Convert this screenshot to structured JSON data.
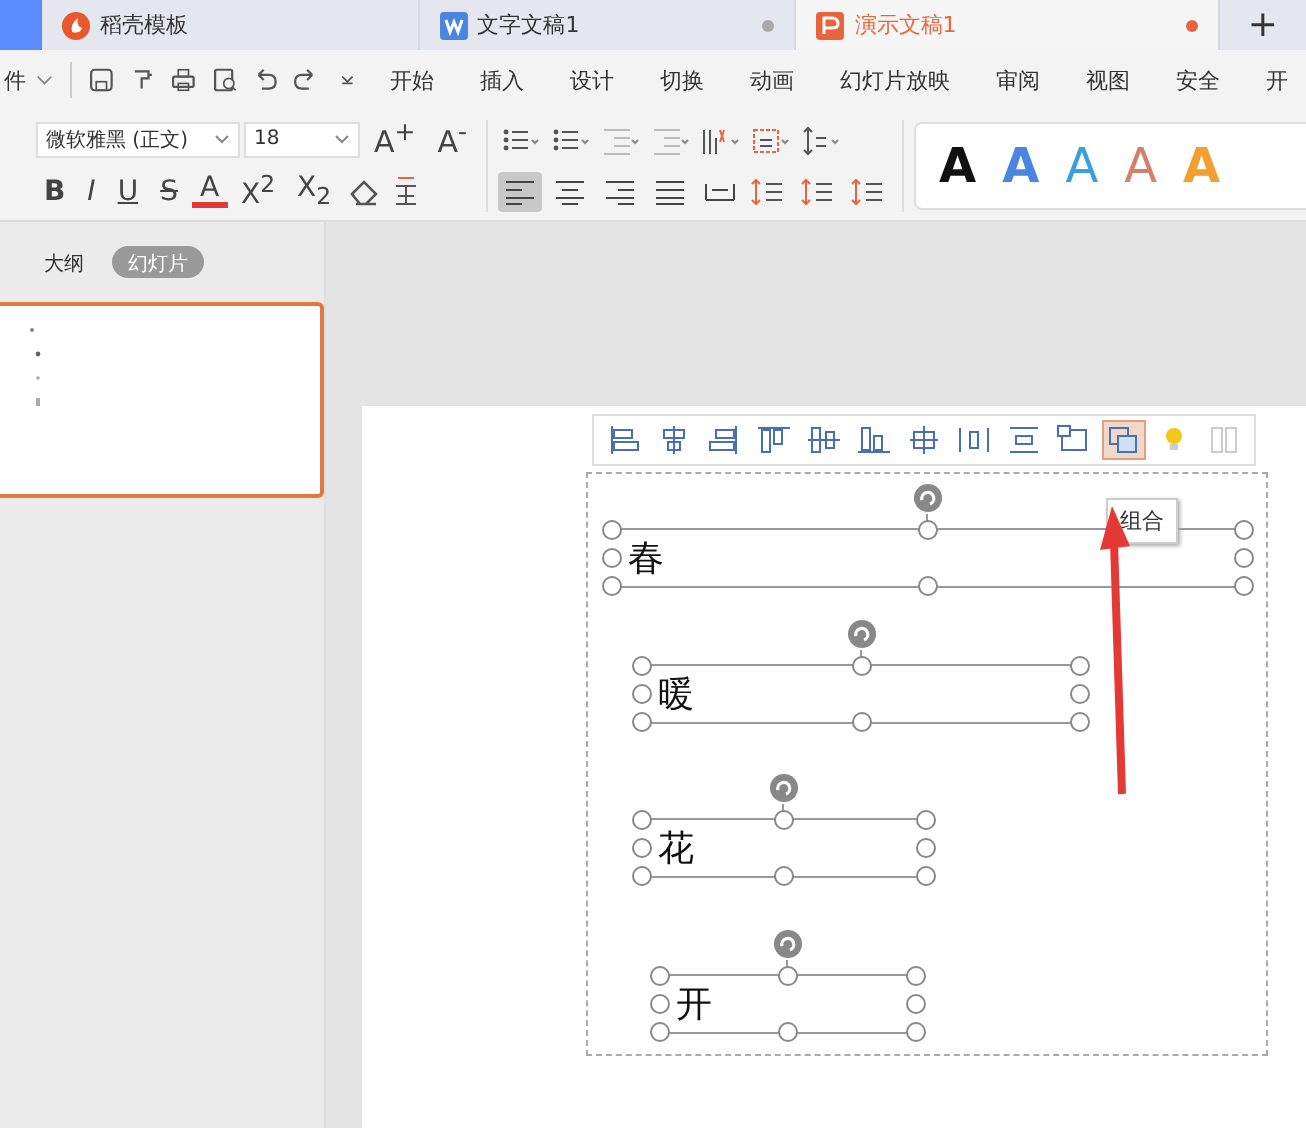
{
  "tabs": [
    {
      "label": "稻壳模板",
      "kind": "template",
      "selected": false,
      "modified": false
    },
    {
      "label": "文字文稿1",
      "kind": "writer",
      "selected": false,
      "modified": true
    },
    {
      "label": "演示文稿1",
      "kind": "presentation",
      "selected": true,
      "modified": true
    }
  ],
  "new_tab": "+",
  "file_menu": "件",
  "menu": [
    "开始",
    "插入",
    "设计",
    "切换",
    "动画",
    "幻灯片放映",
    "审阅",
    "视图",
    "安全",
    "开"
  ],
  "ribbon": {
    "font": "微软雅黑 (正文)",
    "size": "18",
    "size_buttons": [
      "A$^{+}$",
      "A$^{-}$"
    ],
    "format_buttons": [
      {
        "label": "B",
        "kind": "bold"
      },
      {
        "label": "I",
        "kind": "italic"
      },
      {
        "label": "U",
        "kind": "underline"
      },
      {
        "label": "S",
        "kind": "strike"
      },
      {
        "label": "A",
        "kind": "color"
      },
      {
        "label": "X$^{2}$",
        "kind": "plain"
      },
      {
        "label": "X$_{2}$",
        "kind": "plain"
      }
    ],
    "paragraph_align": [
      {
        "kind": "left",
        "selected": true
      },
      {
        "kind": "center",
        "selected": false
      },
      {
        "kind": "right",
        "selected": false
      },
      {
        "kind": "justify",
        "selected": false
      },
      {
        "kind": "distribute",
        "selected": false
      }
    ],
    "text_styles": [
      {
        "label": "A",
        "kind": "filled",
        "color": "#111111"
      },
      {
        "label": "A",
        "kind": "filled",
        "color": "#4a86e0"
      },
      {
        "label": "A",
        "kind": "outline",
        "color": "#3b9ee0"
      },
      {
        "label": "A",
        "kind": "outline",
        "color": "#d4806a"
      },
      {
        "label": "A",
        "kind": "filled",
        "color": "#f0a030"
      }
    ]
  },
  "panel_tabs": [
    {
      "label": "大纲",
      "selected": false
    },
    {
      "label": "幻灯片",
      "selected": true
    }
  ],
  "slide": {
    "align_tools": [
      {
        "kind": "align-left",
        "selected": false
      },
      {
        "kind": "align-center",
        "selected": false
      },
      {
        "kind": "align-right",
        "selected": false
      },
      {
        "kind": "align-top",
        "selected": false
      },
      {
        "kind": "align-middle",
        "selected": false
      },
      {
        "kind": "align-bottom",
        "selected": false
      },
      {
        "kind": "align-both",
        "selected": false
      },
      {
        "kind": "distribute-h",
        "selected": false
      },
      {
        "kind": "distribute-v",
        "selected": false
      },
      {
        "kind": "canvas",
        "selected": false
      },
      {
        "kind": "group",
        "selected": true
      },
      {
        "kind": "bulb",
        "selected": false
      },
      {
        "kind": "more",
        "selected": false
      }
    ],
    "tooltip": "组合",
    "text_boxes": [
      {
        "text": "春"
      },
      {
        "text": "暖"
      },
      {
        "text": "花"
      },
      {
        "text": "开"
      }
    ]
  }
}
